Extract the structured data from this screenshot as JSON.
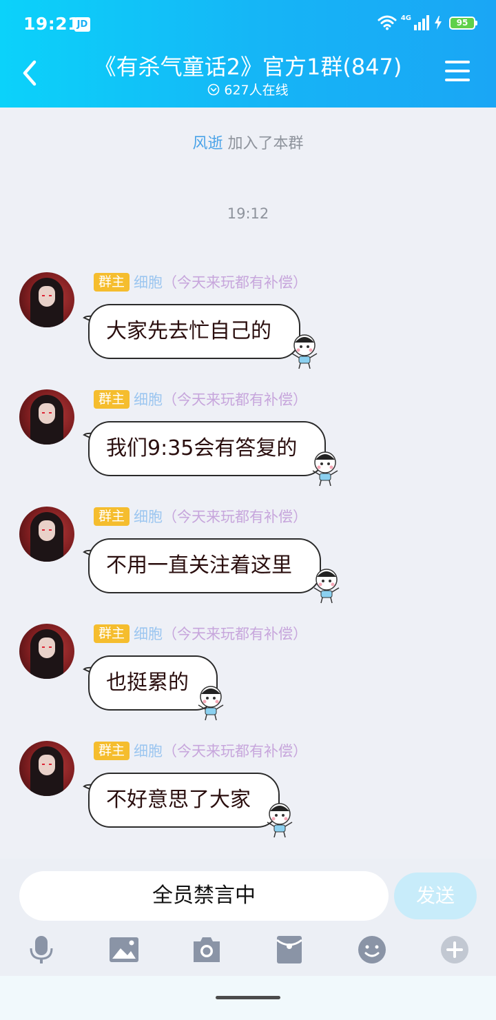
{
  "status_bar": {
    "time": "19:21",
    "app_badge": "JD",
    "network": "4G",
    "battery": "95"
  },
  "header": {
    "title": "《有杀气童话2》官方1群(847)",
    "online": "627人在线"
  },
  "system_notices": {
    "join_user": "风逝",
    "join_text": "加入了本群",
    "timestamp": "19:12"
  },
  "messages": [
    {
      "role": "群主",
      "name": "细胞",
      "note": "（今天来玩都有补偿）",
      "text": "大家先去忙自己的"
    },
    {
      "role": "群主",
      "name": "细胞",
      "note": "（今天来玩都有补偿）",
      "text": "我们9:35会有答复的"
    },
    {
      "role": "群主",
      "name": "细胞",
      "note": "（今天来玩都有补偿）",
      "text": "不用一直关注着这里"
    },
    {
      "role": "群主",
      "name": "细胞",
      "note": "（今天来玩都有补偿）",
      "text": "也挺累的"
    },
    {
      "role": "群主",
      "name": "细胞",
      "note": "（今天来玩都有补偿）",
      "text": "不好意思了大家"
    }
  ],
  "input": {
    "muted_text": "全员禁言中",
    "send_label": "发送"
  },
  "toolbar": [
    "microphone-icon",
    "image-icon",
    "camera-icon",
    "red-packet-icon",
    "emoji-icon",
    "plus-icon"
  ],
  "colors": {
    "header_start": "#0bd2fa",
    "header_end": "#1aa6f5",
    "role_badge": "#f5bd2e",
    "send_button": "#c8ecfa"
  }
}
